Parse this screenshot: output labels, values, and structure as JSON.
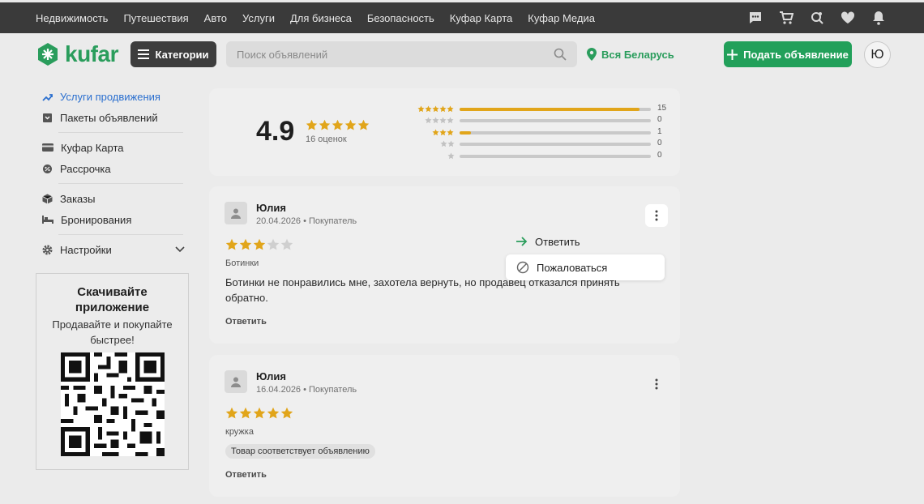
{
  "topnav": [
    "Недвижимость",
    "Путешествия",
    "Авто",
    "Услуги",
    "Для бизнеса",
    "Безопасность",
    "Куфар Карта",
    "Куфар Медиа"
  ],
  "header": {
    "logo": "kufar",
    "categories_label": "Категории",
    "search_placeholder": "Поиск объявлений",
    "region": "Вся Беларусь",
    "post_label": "Подать объявление",
    "avatar_letter": "Ю"
  },
  "sidebar": {
    "items": [
      {
        "label": "Услуги продвижения",
        "icon": "trending-up-icon"
      },
      {
        "label": "Пакеты объявлений",
        "icon": "package-icon"
      },
      {
        "label": "Куфар Карта",
        "icon": "card-icon"
      },
      {
        "label": "Рассрочка",
        "icon": "installment-icon"
      },
      {
        "label": "Заказы",
        "icon": "box-icon"
      },
      {
        "label": "Бронирования",
        "icon": "bed-icon"
      },
      {
        "label": "Настройки",
        "icon": "gear-icon"
      }
    ],
    "app": {
      "title": "Скачивайте приложение",
      "subtitle": "Продавайте и покупайте быстрее!"
    }
  },
  "rating": {
    "score": "4.9",
    "count_label": "16 оценок",
    "distribution": [
      {
        "stars": 5,
        "count": "15",
        "fill": 0.94
      },
      {
        "stars": 4,
        "count": "0",
        "fill": 0
      },
      {
        "stars": 3,
        "count": "1",
        "fill": 0.06
      },
      {
        "stars": 2,
        "count": "0",
        "fill": 0
      },
      {
        "stars": 1,
        "count": "0",
        "fill": 0
      }
    ]
  },
  "reviews": [
    {
      "name": "Юлия",
      "meta": "20.04.2026 • Покупатель",
      "stars": 3,
      "category": "Ботинки",
      "text": "Ботинки не понравились мне, захотела вернуть, но продавец отказался принять обратно.",
      "reply_label": "Ответить"
    },
    {
      "name": "Юлия",
      "meta": "16.04.2026 • Покупатель",
      "stars": 5,
      "category": "кружка",
      "tag": "Товар соответствует объявлению",
      "reply_label": "Ответить"
    }
  ],
  "context_menu": {
    "reply": "Ответить",
    "report": "Пожаловаться"
  },
  "colors": {
    "brand_green": "#22a05a",
    "star_gold": "#e1a51a",
    "active_blue": "#2a6fcf"
  }
}
